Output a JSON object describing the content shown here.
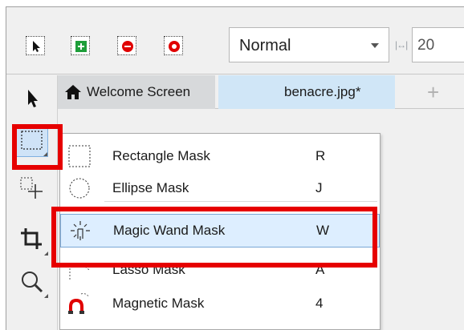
{
  "toolbar": {
    "buttons": [
      {
        "name": "new-mask-button",
        "icon": "arrow-select-icon"
      },
      {
        "name": "add-to-mask-button",
        "icon": "plus-mask-icon"
      },
      {
        "name": "subtract-from-mask-button",
        "icon": "minus-mask-icon"
      },
      {
        "name": "xor-mask-button",
        "icon": "xor-mask-icon"
      }
    ],
    "mode_value": "Normal",
    "tolerance_value": "20"
  },
  "tabs": {
    "home_label": "Welcome Screen",
    "document_label": "benacre.jpg*",
    "add_label": "+"
  },
  "flyout": {
    "items": [
      {
        "label": "Rectangle Mask",
        "shortcut": "R",
        "icon": "rectangle-mask-icon"
      },
      {
        "label": "Ellipse Mask",
        "shortcut": "J",
        "icon": "ellipse-mask-icon"
      },
      {
        "label": "Magic Wand Mask",
        "shortcut": "W",
        "icon": "magic-wand-icon",
        "highlighted": true
      },
      {
        "label": "Lasso Mask",
        "shortcut": "A",
        "icon": "lasso-icon"
      },
      {
        "label": "Magnetic Mask",
        "shortcut": "4",
        "icon": "magnet-icon"
      }
    ]
  },
  "colors": {
    "highlight_border": "#e60000",
    "hover_fill": "#ddeeff",
    "hover_border": "#7aa7d6",
    "add_green": "#1e9e3a",
    "remove_red": "#e00000"
  }
}
